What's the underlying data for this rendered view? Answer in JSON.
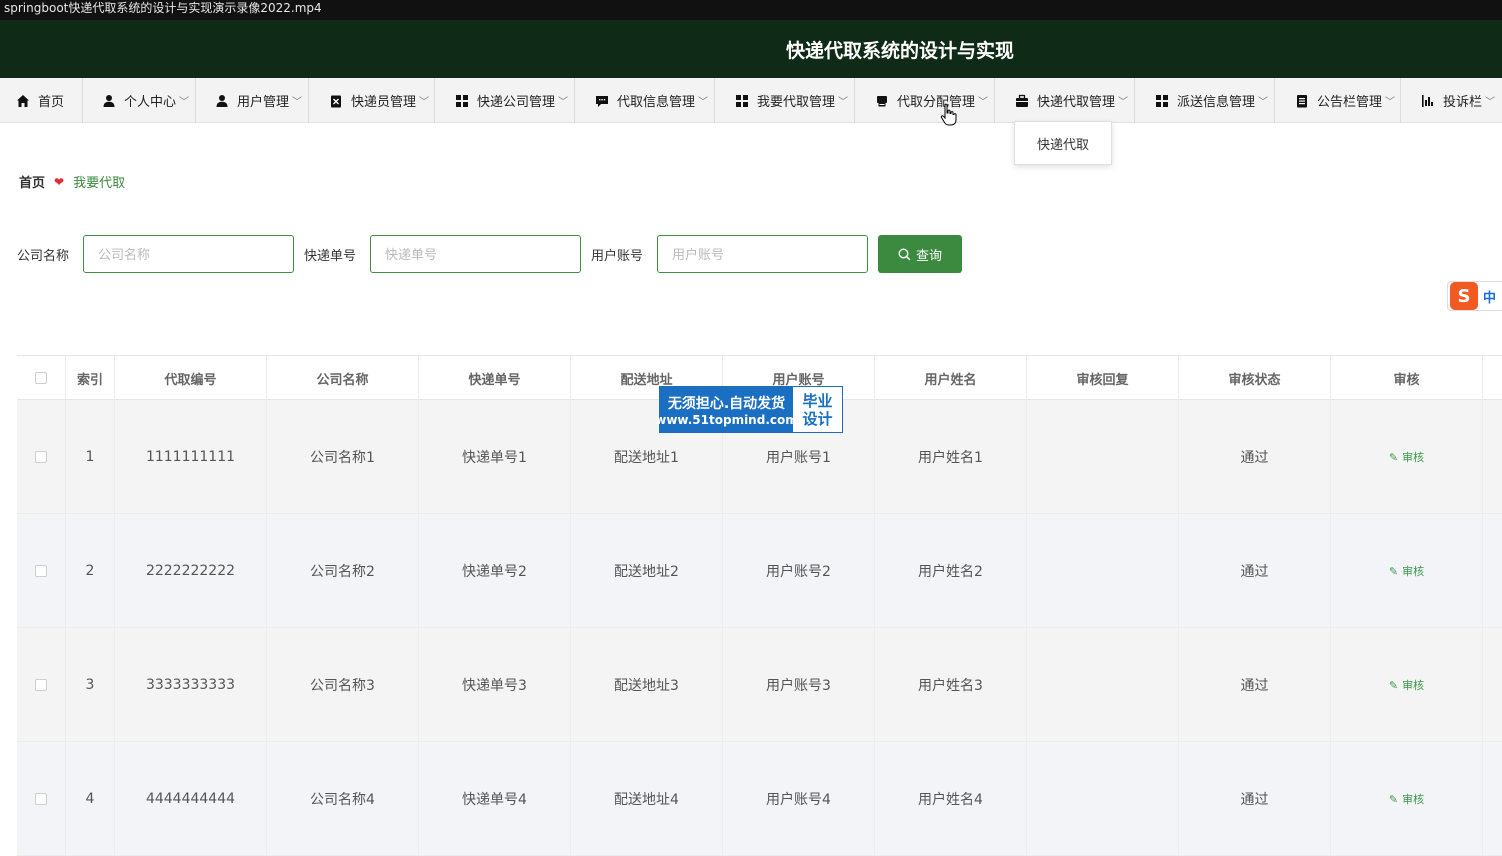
{
  "window": {
    "title": "springboot快递代取系统的设计与实现演示录像2022.mp4"
  },
  "header": {
    "title": "快递代取系统的设计与实现"
  },
  "nav": {
    "items": [
      {
        "label": "首页",
        "icon": "home-icon",
        "dropdown": false
      },
      {
        "label": "个人中心",
        "icon": "user-icon",
        "dropdown": true
      },
      {
        "label": "用户管理",
        "icon": "user-icon",
        "dropdown": true
      },
      {
        "label": "快递员管理",
        "icon": "clipboard-icon",
        "dropdown": true
      },
      {
        "label": "快递公司管理",
        "icon": "grid-icon",
        "dropdown": true
      },
      {
        "label": "代取信息管理",
        "icon": "chat-icon",
        "dropdown": true
      },
      {
        "label": "我要代取管理",
        "icon": "grid-icon",
        "dropdown": true
      },
      {
        "label": "代取分配管理",
        "icon": "print-icon",
        "dropdown": true
      },
      {
        "label": "快递代取管理",
        "icon": "briefcase-icon",
        "dropdown": true
      },
      {
        "label": "派送信息管理",
        "icon": "grid-icon",
        "dropdown": true
      },
      {
        "label": "公告栏管理",
        "icon": "document-icon",
        "dropdown": true
      },
      {
        "label": "投诉栏",
        "icon": "bar-chart-icon",
        "dropdown": true
      }
    ],
    "open_dropdown": {
      "items": [
        "快递代取"
      ]
    }
  },
  "breadcrumb": {
    "home": "首页",
    "current": "我要代取"
  },
  "search": {
    "company_label": "公司名称",
    "company_placeholder": "公司名称",
    "company_value": "",
    "tracking_label": "快递单号",
    "tracking_placeholder": "快递单号",
    "tracking_value": "",
    "account_label": "用户账号",
    "account_placeholder": "用户账号",
    "account_value": "",
    "button_label": "查询"
  },
  "ime": {
    "logo": "S",
    "mode": "中"
  },
  "table": {
    "headers": [
      "",
      "索引",
      "代取编号",
      "公司名称",
      "快递单号",
      "配送地址",
      "用户账号",
      "用户姓名",
      "审核回复",
      "审核状态",
      "审核"
    ],
    "rows": [
      {
        "index": "1",
        "code": "1111111111",
        "company": "公司名称1",
        "tracking": "快递单号1",
        "address": "配送地址1",
        "account": "用户账号1",
        "name": "用户姓名1",
        "reply": "",
        "status": "通过",
        "action": "审核"
      },
      {
        "index": "2",
        "code": "2222222222",
        "company": "公司名称2",
        "tracking": "快递单号2",
        "address": "配送地址2",
        "account": "用户账号2",
        "name": "用户姓名2",
        "reply": "",
        "status": "通过",
        "action": "审核"
      },
      {
        "index": "3",
        "code": "3333333333",
        "company": "公司名称3",
        "tracking": "快递单号3",
        "address": "配送地址3",
        "account": "用户账号3",
        "name": "用户姓名3",
        "reply": "",
        "status": "通过",
        "action": "审核"
      },
      {
        "index": "4",
        "code": "4444444444",
        "company": "公司名称4",
        "tracking": "快递单号4",
        "address": "配送地址4",
        "account": "用户账号4",
        "name": "用户姓名4",
        "reply": "",
        "status": "通过",
        "action": "审核"
      }
    ]
  },
  "watermark": {
    "line1": "无须担心.自动发货",
    "line2": "www.51topmind.com",
    "right1": "毕业",
    "right2": "设计"
  },
  "colors": {
    "header_bg": "#0f2a16",
    "accent": "#3b8a3f",
    "watermark": "#1a6fc2"
  }
}
